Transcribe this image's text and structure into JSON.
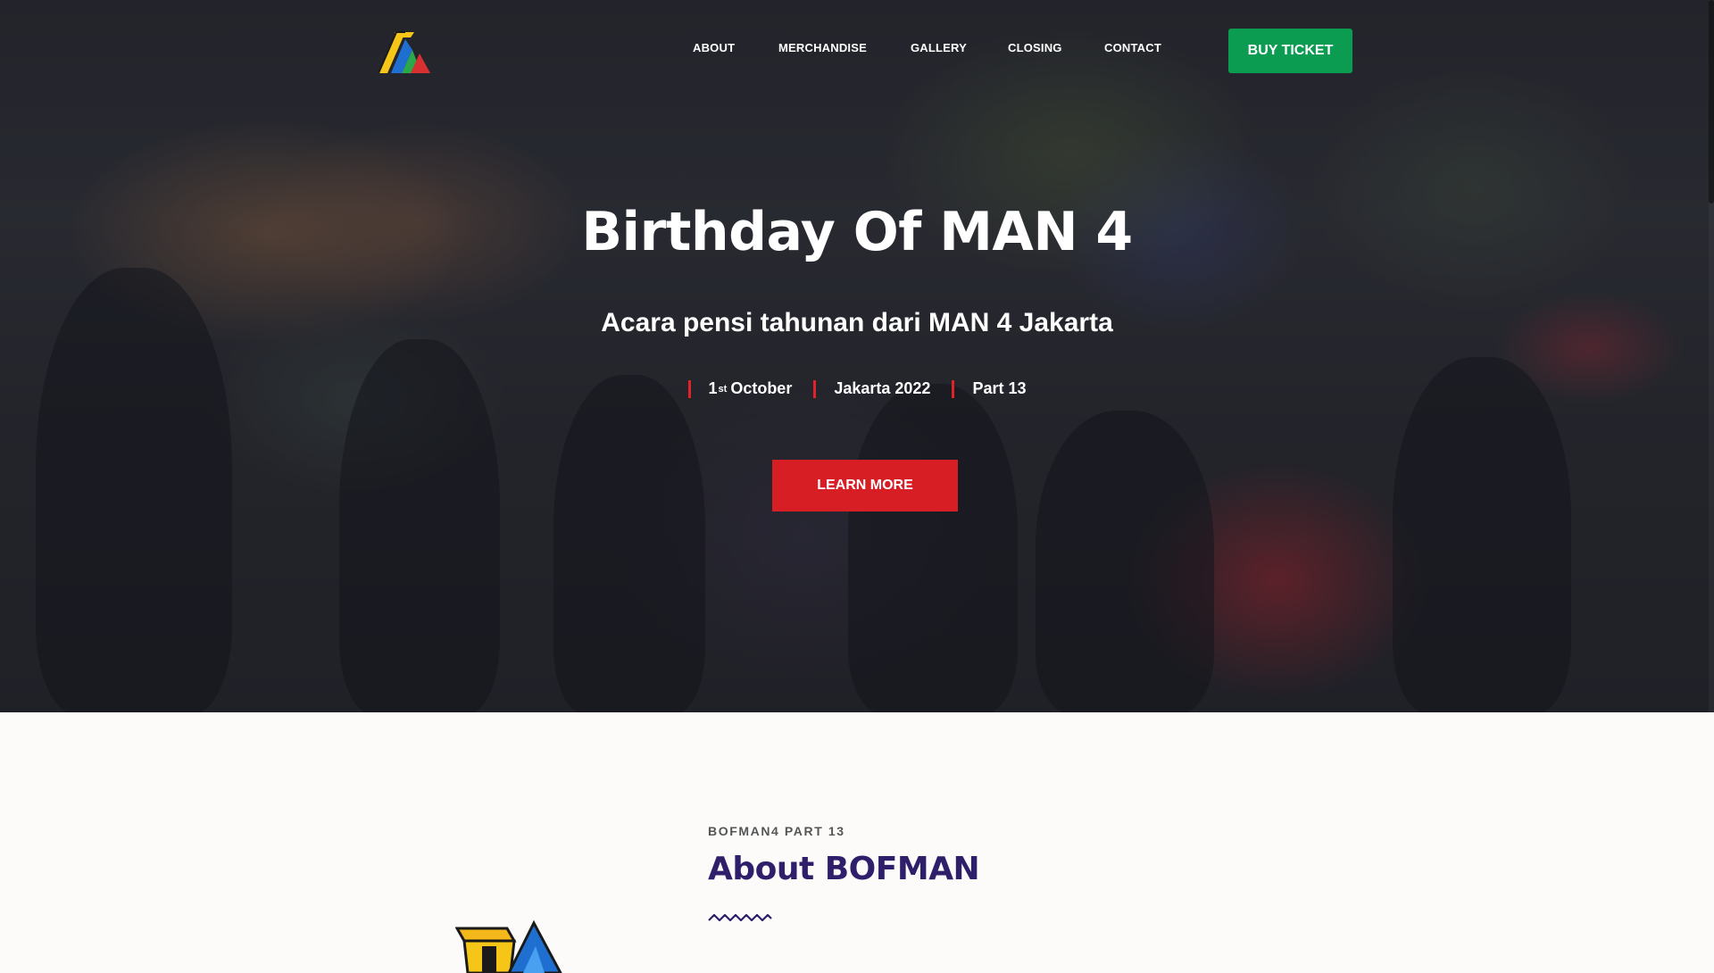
{
  "nav": {
    "items": [
      {
        "label": "ABOUT"
      },
      {
        "label": "MERCHANDISE"
      },
      {
        "label": "GALLERY"
      },
      {
        "label": "CLOSING"
      },
      {
        "label": "CONTACT"
      }
    ],
    "buy_ticket_label": "BUY TICKET"
  },
  "hero": {
    "title": "Birthday Of MAN 4",
    "subtitle": "Acara pensi tahunan dari MAN 4 Jakarta",
    "meta": {
      "date_day": "1",
      "date_suffix": "st",
      "date_month": "October",
      "location": "Jakarta 2022",
      "part": "Part 13"
    },
    "learn_more_label": "LEARN MORE"
  },
  "about": {
    "kicker": "BOFMAN4 PART 13",
    "title": "About BOFMAN"
  },
  "colors": {
    "buy_ticket_bg": "#0b9c52",
    "learn_more_bg": "#d81e25",
    "meta_divider": "#e0222b",
    "about_title": "#2f1f6b"
  },
  "icons": {
    "logo": "bofman-logo-icon",
    "about_logo": "bofman-logo-icon",
    "divider": "zigzag-divider-icon"
  }
}
